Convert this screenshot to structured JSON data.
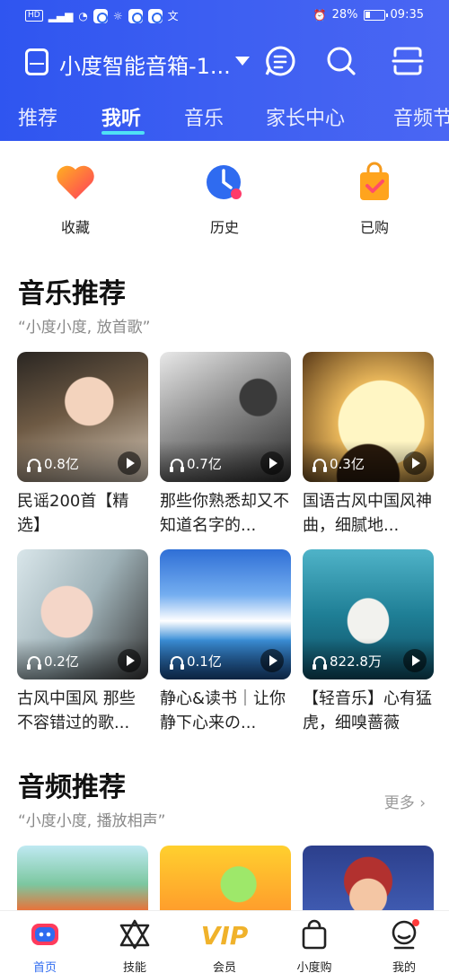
{
  "status_bar": {
    "network_badge": "HD",
    "signal": "⁴⁶",
    "battery": "28%",
    "time": "09:35"
  },
  "header": {
    "device_name": "小度智能音箱-1...",
    "tabs": [
      "推荐",
      "我听",
      "音乐",
      "家长中心",
      "音频节"
    ],
    "active_tab": 1
  },
  "quick_actions": [
    {
      "label": "收藏",
      "icon": "heart-icon"
    },
    {
      "label": "历史",
      "icon": "history-icon"
    },
    {
      "label": "已购",
      "icon": "purchased-bag-icon"
    }
  ],
  "music_section": {
    "title": "音乐推荐",
    "subtitle": "“小度小度, 放首歌”",
    "cards": [
      {
        "plays": "0.8亿",
        "title": "民谣200首【精选】"
      },
      {
        "plays": "0.7亿",
        "title": "那些你熟悉却又不知道名字的..."
      },
      {
        "plays": "0.3亿",
        "title": "国语古风中国风神曲，细腻地..."
      },
      {
        "plays": "0.2亿",
        "title": "古风中国风 那些不容错过的歌..."
      },
      {
        "plays": "0.1亿",
        "title": "静心&读书｜让你静下心来の..."
      },
      {
        "plays": "822.8万",
        "title": "【轻音乐】心有猛虎，细嗅蔷薇"
      }
    ]
  },
  "audio_section": {
    "title": "音频推荐",
    "subtitle": "“小度小度, 播放相声”",
    "more": "更多"
  },
  "bottom_nav": [
    {
      "label": "首页",
      "icon": "home-icon"
    },
    {
      "label": "技能",
      "icon": "skills-icon"
    },
    {
      "label": "会员",
      "icon": "vip-icon"
    },
    {
      "label": "小度购",
      "icon": "shopping-bag-icon"
    },
    {
      "label": "我的",
      "icon": "profile-icon"
    }
  ],
  "colors": {
    "header_blue": "#2f55f0",
    "tab_underline": "#4fe0f5",
    "active_nav": "#2f6bf0"
  }
}
